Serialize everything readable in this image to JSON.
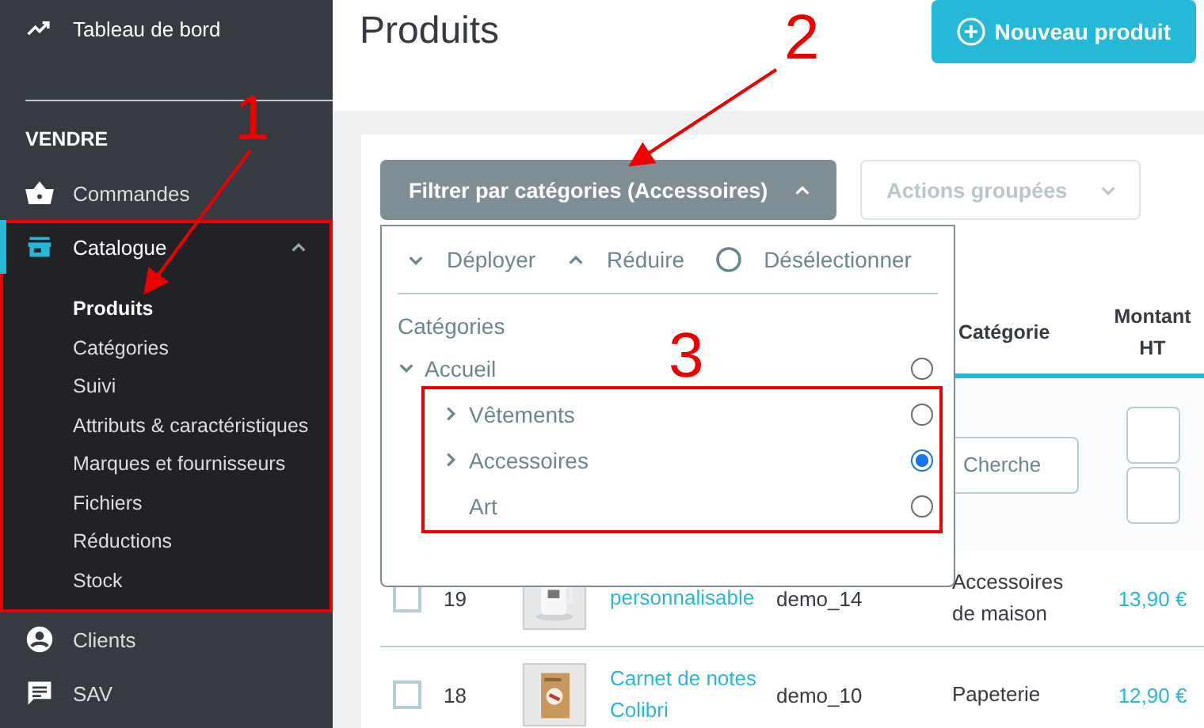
{
  "sidebar": {
    "top_item": {
      "label": "Tableau de bord"
    },
    "section": "VENDRE",
    "items": [
      {
        "label": "Commandes",
        "expanded": false,
        "highlighted": false
      },
      {
        "label": "Catalogue",
        "expanded": true,
        "highlighted": true,
        "children": [
          {
            "label": "Produits",
            "selected": true
          },
          {
            "label": "Catégories",
            "selected": false
          },
          {
            "label": "Suivi",
            "selected": false
          },
          {
            "label": "Attributs & caractéristiques",
            "selected": false
          },
          {
            "label": "Marques et fournisseurs",
            "selected": false
          },
          {
            "label": "Fichiers",
            "selected": false
          },
          {
            "label": "Réductions",
            "selected": false
          },
          {
            "label": "Stock",
            "selected": false
          }
        ]
      },
      {
        "label": "Clients",
        "expanded": false,
        "highlighted": false
      },
      {
        "label": "SAV",
        "expanded": false,
        "highlighted": false
      }
    ]
  },
  "header": {
    "title": "Produits",
    "new_button": "Nouveau produit"
  },
  "toolbar": {
    "filter_button": "Filtrer par catégories (Accessoires)",
    "filter_open": true,
    "bulk_actions": "Actions groupées",
    "bulk_disabled": true
  },
  "category_dropdown": {
    "actions": [
      {
        "label": "Déployer"
      },
      {
        "label": "Réduire"
      },
      {
        "label": "Désélectionner"
      }
    ],
    "heading": "Catégories",
    "tree": [
      {
        "label": "Accueil",
        "expandable": true,
        "expanded": true,
        "selected": false,
        "children_highlighted": true,
        "children": [
          {
            "label": "Vêtements",
            "expandable": true,
            "expanded": false,
            "selected": false
          },
          {
            "label": "Accessoires",
            "expandable": true,
            "expanded": false,
            "selected": true
          },
          {
            "label": "Art",
            "expandable": false,
            "selected": false
          }
        ]
      }
    ]
  },
  "table": {
    "columns": [
      {
        "label": "Catégorie"
      },
      {
        "label": "Montant HT"
      }
    ],
    "category_filter": {
      "placeholder": "Cherche"
    },
    "rows": [
      {
        "checked": false,
        "id": "19",
        "name": "personnalisable",
        "reference": "demo_14",
        "category": "Accessoires de maison",
        "price": "13,90 €"
      },
      {
        "checked": false,
        "id": "18",
        "name": "Carnet de notes Colibri",
        "reference": "demo_10",
        "category": "Papeterie",
        "price": "12,90 €"
      }
    ]
  },
  "annotations": [
    {
      "label": "1",
      "arrow": true
    },
    {
      "label": "2",
      "arrow": true
    },
    {
      "label": "3",
      "arrow": false
    }
  ]
}
